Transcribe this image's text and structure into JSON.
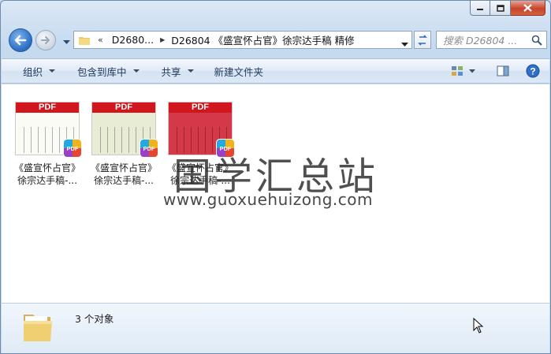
{
  "address": {
    "chevrons": "«",
    "crumbs": [
      "D2680...",
      "D26804 《盛宣怀占官》徐宗达手稿 精修"
    ]
  },
  "search": {
    "placeholder": "搜索 D26804 ..."
  },
  "toolbar": {
    "organize": "组织",
    "include_library": "包含到库中",
    "share": "共享",
    "new_folder": "新建文件夹"
  },
  "files": [
    {
      "badge": "PDF",
      "line1": "《盛宣怀占官》",
      "line2": "徐宗达手稿-...",
      "icon_badge": "PDF"
    },
    {
      "badge": "PDF",
      "line1": "《盛宣怀占官》",
      "line2": "徐宗达手稿-...",
      "icon_badge": "PDF"
    },
    {
      "badge": "PDF",
      "line1": "《盛宣怀占官》",
      "line2": "徐宗达手稿-...",
      "icon_badge": "PDF"
    }
  ],
  "watermark": {
    "title": "国学汇总站",
    "url": "www.guoxuehuizong.com"
  },
  "details": {
    "count": "3 个对象"
  },
  "colors": {
    "pdf_red": "#d2161e",
    "window_frame": "#c5d9ef",
    "close_red": "#c8442a"
  }
}
